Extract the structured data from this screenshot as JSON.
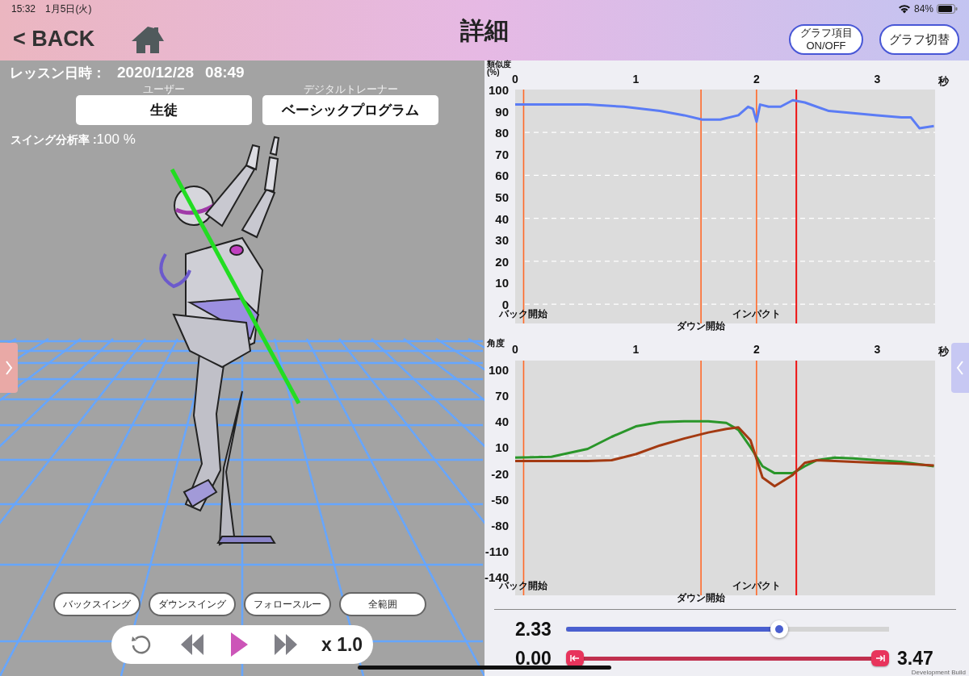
{
  "status_bar": {
    "time": "15:32",
    "date": "1月5日(火)",
    "battery": "84%"
  },
  "header": {
    "back": "< BACK",
    "title": "詳細",
    "buttons": [
      "グラフ項目\nON/OFF",
      "グラフ切替"
    ]
  },
  "lesson": {
    "datetime_label": "レッスン日時：",
    "date": "2020/12/28",
    "time": "08:49",
    "fields": [
      {
        "caption": "ユーザー",
        "value": "生徒"
      },
      {
        "caption": "デジタルトレーナー",
        "value": "ベーシックプログラム"
      }
    ],
    "rate_label": "スイング分析率 :",
    "rate": "100 %"
  },
  "range_buttons": [
    "バックスイング",
    "ダウンスイング",
    "フォロースルー",
    "全範囲"
  ],
  "playback": {
    "speed": "x 1.0"
  },
  "graphs": [
    {
      "chart_data": {
        "type": "line",
        "ylabel": "類似度(%)",
        "xlabel": "秒",
        "xlim": [
          0,
          3.48
        ],
        "ylim": [
          -9,
          100
        ],
        "xticks": [
          0,
          1,
          2,
          3
        ],
        "yticks": [
          100,
          90,
          80,
          70,
          60,
          50,
          40,
          30,
          20,
          10,
          0
        ],
        "grid": true,
        "x": [
          0,
          0.3,
          0.6,
          0.9,
          1.2,
          1.4,
          1.55,
          1.7,
          1.85,
          1.93,
          1.97,
          2.0,
          2.03,
          2.1,
          2.2,
          2.3,
          2.4,
          2.6,
          2.8,
          3.0,
          3.2,
          3.28,
          3.35,
          3.47
        ],
        "series": [
          {
            "color": "#5b7cf5",
            "values": [
              93,
              93,
              93,
              92,
              90,
              88,
              86,
              86,
              88,
              92,
              91,
              85,
              93,
              92,
              92,
              95,
              94,
              90,
              89,
              88,
              87,
              87,
              82,
              83
            ]
          }
        ],
        "ref_lines": [
          {
            "axis": "x",
            "value": 0.07,
            "label": "バック開始",
            "color": "#ff6a2a"
          },
          {
            "axis": "x",
            "value": 1.54,
            "label": "ダウン開始",
            "color": "#ff6a2a"
          },
          {
            "axis": "x",
            "value": 2.0,
            "label": "インパクト",
            "color": "#ff6a2a"
          },
          {
            "axis": "x",
            "value": 2.33,
            "color": "#ee1111"
          }
        ]
      }
    },
    {
      "chart_data": {
        "type": "line",
        "ylabel": "角度",
        "xlabel": "秒",
        "xlim": [
          0,
          3.48
        ],
        "ylim": [
          -161,
          110
        ],
        "xticks": [
          0,
          1,
          2,
          3
        ],
        "yticks": [
          100,
          70,
          40,
          10,
          -20,
          -50,
          -80,
          -110,
          -140
        ],
        "grid": false,
        "x": [
          0,
          0.3,
          0.6,
          0.8,
          1.0,
          1.2,
          1.4,
          1.6,
          1.75,
          1.85,
          1.95,
          2.05,
          2.15,
          2.3,
          2.4,
          2.5,
          2.65,
          2.8,
          3.0,
          3.2,
          3.47
        ],
        "series": [
          {
            "color": "#2a962a",
            "values": [
              -2,
              -1,
              8,
              22,
              34,
              39,
              40,
              40,
              38,
              30,
              10,
              -12,
              -20,
              -20,
              -12,
              -5,
              -2,
              -3,
              -5,
              -7,
              -12
            ]
          },
          {
            "color": "#a33a12",
            "values": [
              -6,
              -6,
              -6,
              -5,
              2,
              12,
              20,
              27,
              31,
              33,
              18,
              -25,
              -35,
              -22,
              -8,
              -5,
              -6,
              -7,
              -8,
              -9,
              -11
            ]
          }
        ],
        "ref_lines": [
          {
            "axis": "y",
            "value": 0,
            "color": "#ffffff"
          },
          {
            "axis": "x",
            "value": 0.07,
            "label": "バック開始",
            "color": "#ff6a2a"
          },
          {
            "axis": "x",
            "value": 1.54,
            "label": "ダウン開始",
            "color": "#ff6a2a"
          },
          {
            "axis": "x",
            "value": 2.0,
            "label": "インパクト",
            "color": "#ff6a2a"
          },
          {
            "axis": "x",
            "value": 2.33,
            "color": "#ee1111"
          }
        ]
      }
    }
  ],
  "time_slider": {
    "reading": "2.33",
    "level": 0.67
  },
  "range_slider": {
    "start": "0.00",
    "end": "3.47",
    "handles": [
      {
        "level": 0
      },
      {
        "level": 1
      }
    ]
  },
  "build_label": "Development Build"
}
